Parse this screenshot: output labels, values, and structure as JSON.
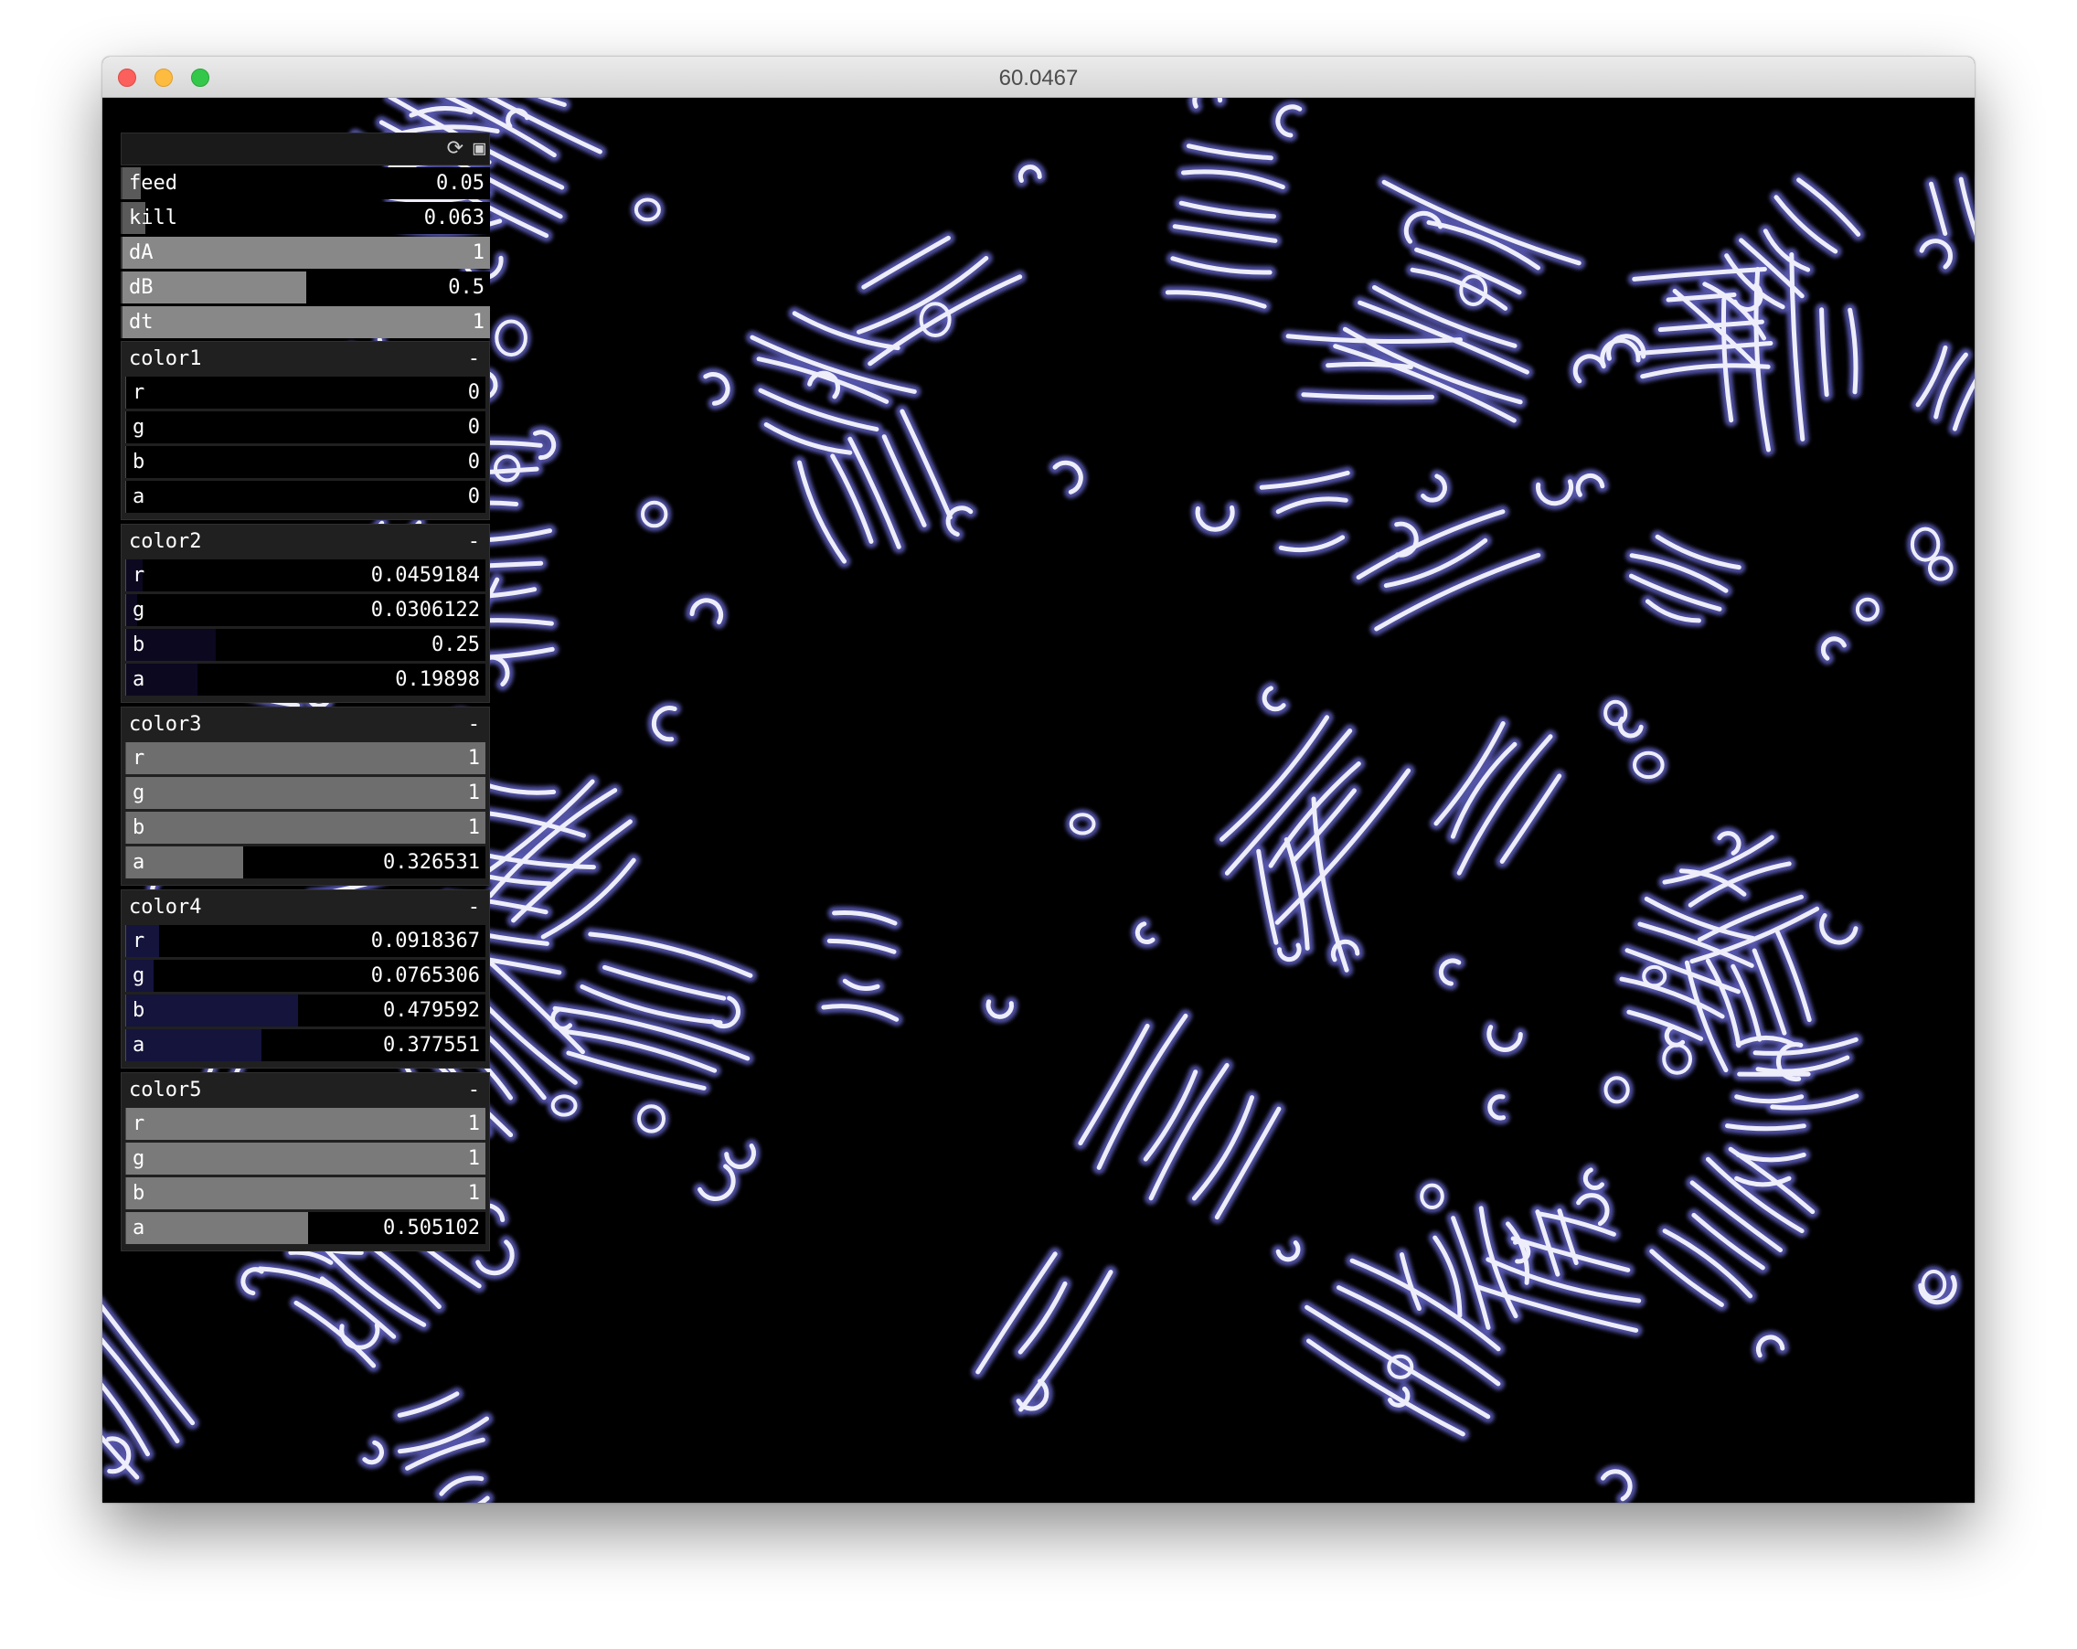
{
  "window": {
    "title": "60.0467"
  },
  "gui": {
    "header_icons": {
      "reload": "reload-icon",
      "save": "save-icon"
    },
    "params": [
      {
        "label": "feed",
        "value": "0.05",
        "fraction": 0.05,
        "color": "#5a5a5a"
      },
      {
        "label": "kill",
        "value": "0.063",
        "fraction": 0.063,
        "color": "#5a5a5a"
      },
      {
        "label": "dA",
        "value": "1",
        "fraction": 1.0,
        "color": "#888888"
      },
      {
        "label": "dB",
        "value": "0.5",
        "fraction": 0.5,
        "color": "#888888"
      },
      {
        "label": "dt",
        "value": "1",
        "fraction": 1.0,
        "color": "#888888"
      }
    ],
    "groups": [
      {
        "name": "color1",
        "minimize": "-",
        "rows": [
          {
            "label": "r",
            "value": "0",
            "fraction": 0,
            "color": "#555555"
          },
          {
            "label": "g",
            "value": "0",
            "fraction": 0,
            "color": "#555555"
          },
          {
            "label": "b",
            "value": "0",
            "fraction": 0,
            "color": "#555555"
          },
          {
            "label": "a",
            "value": "0",
            "fraction": 0,
            "color": "#555555"
          }
        ]
      },
      {
        "name": "color2",
        "minimize": "-",
        "rows": [
          {
            "label": "r",
            "value": "0.0459184",
            "fraction": 0.0459184,
            "color": "#0c0820"
          },
          {
            "label": "g",
            "value": "0.0306122",
            "fraction": 0.0306122,
            "color": "#0c0820"
          },
          {
            "label": "b",
            "value": "0.25",
            "fraction": 0.25,
            "color": "#0c0820"
          },
          {
            "label": "a",
            "value": "0.19898",
            "fraction": 0.19898,
            "color": "#0c0820"
          }
        ]
      },
      {
        "name": "color3",
        "minimize": "-",
        "rows": [
          {
            "label": "r",
            "value": "1",
            "fraction": 1,
            "color": "#6e6e6e"
          },
          {
            "label": "g",
            "value": "1",
            "fraction": 1,
            "color": "#6e6e6e"
          },
          {
            "label": "b",
            "value": "1",
            "fraction": 1,
            "color": "#6e6e6e"
          },
          {
            "label": "a",
            "value": "0.326531",
            "fraction": 0.326531,
            "color": "#6e6e6e"
          }
        ]
      },
      {
        "name": "color4",
        "minimize": "-",
        "rows": [
          {
            "label": "r",
            "value": "0.0918367",
            "fraction": 0.0918367,
            "color": "#14143c"
          },
          {
            "label": "g",
            "value": "0.0765306",
            "fraction": 0.0765306,
            "color": "#14143c"
          },
          {
            "label": "b",
            "value": "0.479592",
            "fraction": 0.479592,
            "color": "#14143c"
          },
          {
            "label": "a",
            "value": "0.377551",
            "fraction": 0.377551,
            "color": "#14143c"
          }
        ]
      },
      {
        "name": "color5",
        "minimize": "-",
        "rows": [
          {
            "label": "r",
            "value": "1",
            "fraction": 1,
            "color": "#7a7a7a"
          },
          {
            "label": "g",
            "value": "1",
            "fraction": 1,
            "color": "#7a7a7a"
          },
          {
            "label": "b",
            "value": "1",
            "fraction": 1,
            "color": "#7a7a7a"
          },
          {
            "label": "a",
            "value": "0.505102",
            "fraction": 0.505102,
            "color": "#7a7a7a"
          }
        ]
      }
    ]
  },
  "colors": {
    "background": "#000000",
    "pattern_glow": "#5a5ab4",
    "pattern_core": "#eeeefa"
  }
}
